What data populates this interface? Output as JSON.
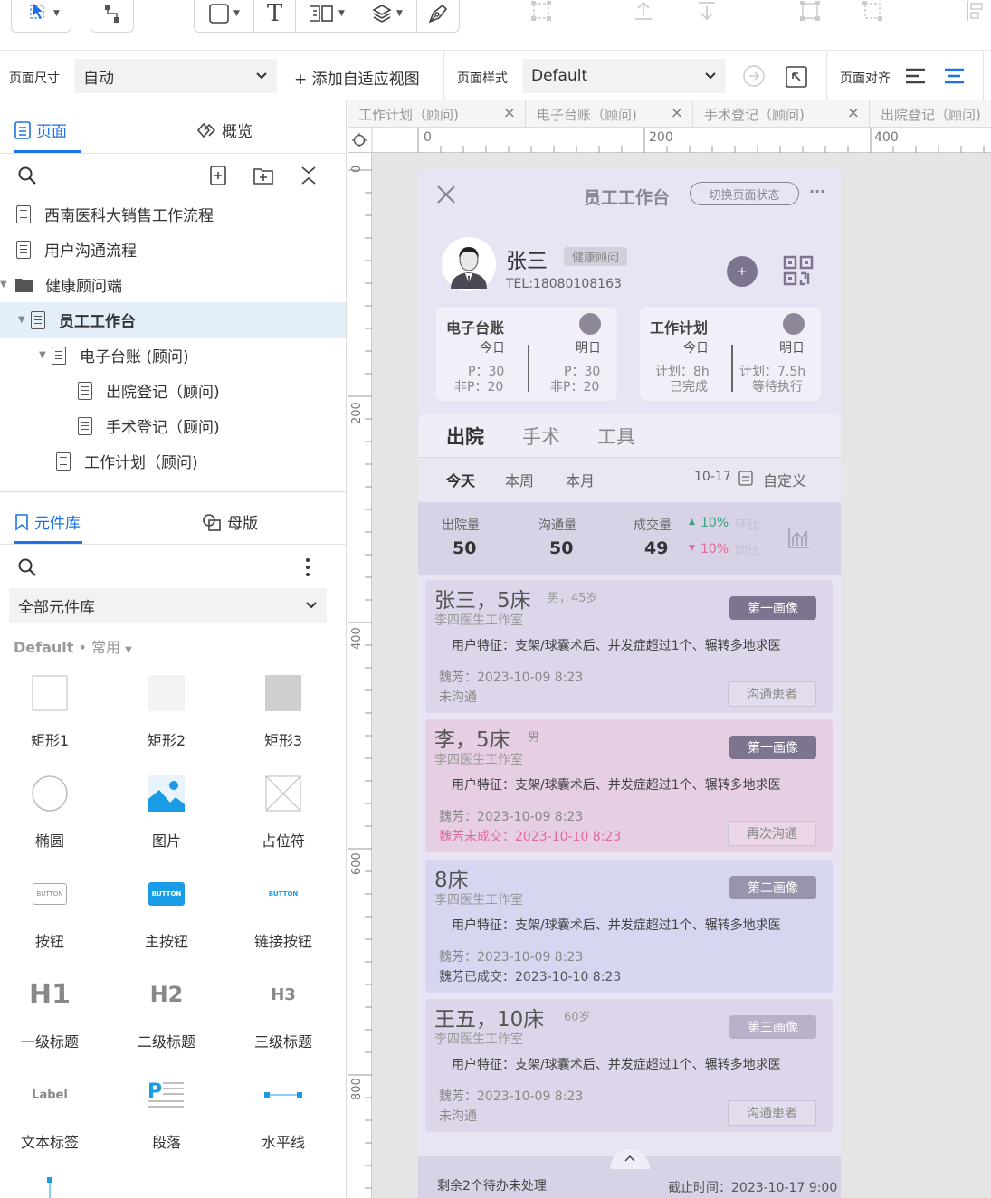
{
  "toolbar": {
    "text_tool": "T",
    "align_icons": [
      "align-top-icon",
      "align-bottom-icon",
      "distribute-h-icon",
      "distribute-v-icon",
      "send-back-icon",
      "bring-front-icon",
      "align-left-icon"
    ]
  },
  "pagebar": {
    "size_label": "页面尺寸",
    "size_value": "自动",
    "add_adaptive": "+ 添加自适应视图",
    "style_label": "页面样式",
    "style_value": "Default",
    "align_label": "页面对齐"
  },
  "left": {
    "tabs": {
      "pages": "页面",
      "overview": "概览"
    },
    "tree": [
      {
        "label": "西南医科大销售工作流程"
      },
      {
        "label": "用户沟通流程"
      },
      {
        "label": "健康顾问端"
      },
      {
        "label": "员工工作台"
      },
      {
        "label": "电子台账 (顾问)"
      },
      {
        "label": "出院登记（顾问)"
      },
      {
        "label": "手术登记（顾问)"
      },
      {
        "label": "工作计划（顾问)"
      }
    ],
    "lib_tabs": {
      "library": "元件库",
      "masters": "母版"
    },
    "lib_select": "全部元件库",
    "lib_default": "Default",
    "lib_dot": "•",
    "lib_common": "常用",
    "components": [
      {
        "label": "矩形1"
      },
      {
        "label": "矩形2"
      },
      {
        "label": "矩形3"
      },
      {
        "label": "椭圆"
      },
      {
        "label": "图片"
      },
      {
        "label": "占位符"
      },
      {
        "label": "按钮",
        "btn": "BUTTON"
      },
      {
        "label": "主按钮",
        "btn": "BUTTON"
      },
      {
        "label": "链接按钮",
        "btn": "BUTTON"
      },
      {
        "label": "一级标题",
        "glyph": "H1"
      },
      {
        "label": "二级标题",
        "glyph": "H2"
      },
      {
        "label": "三级标题",
        "glyph": "H3"
      },
      {
        "label": "文本标签",
        "glyph": "Label"
      },
      {
        "label": "段落"
      },
      {
        "label": "水平线"
      }
    ]
  },
  "editor_tabs": [
    {
      "label": "工作计划（顾问)"
    },
    {
      "label": "电子台账（顾问)"
    },
    {
      "label": "手术登记（顾问)"
    },
    {
      "label": "出院登记（顾问)"
    }
  ],
  "ruler": {
    "h": [
      "0",
      "200",
      "400"
    ],
    "v": [
      "0",
      "200",
      "400",
      "600",
      "800"
    ]
  },
  "phone": {
    "title": "员工工作台",
    "switch_state": "切换页面状态",
    "more": "···",
    "user": {
      "name": "张三",
      "role": "健康顾问",
      "tel": "TEL:18080108163"
    },
    "ledger": {
      "title": "电子台账",
      "today": "今日",
      "tomorrow": "明日",
      "today_p": "P：30",
      "today_np": "非P：20",
      "tomorrow_p": "P：30",
      "tomorrow_np": "非P：20"
    },
    "plan": {
      "title": "工作计划",
      "today": "今日",
      "tomorrow": "明日",
      "today_plan": "计划：8h",
      "today_status": "已完成",
      "tomorrow_plan": "计划：7.5h",
      "tomorrow_status": "等待执行"
    },
    "tabs": [
      "出院",
      "手术",
      "工具"
    ],
    "periods": [
      "今天",
      "本周",
      "本月"
    ],
    "date": "10-17",
    "custom": "自定义",
    "stats": {
      "discharge_label": "出院量",
      "discharge_value": "50",
      "comm_label": "沟通量",
      "comm_value": "50",
      "deal_label": "成交量",
      "deal_value": "49",
      "mom_value": "10%",
      "mom_label": "环比",
      "yoy_value": "10%",
      "yoy_label": "同比"
    },
    "cards": [
      {
        "name": "张三，5床",
        "meta": "男，45岁",
        "clinic": "李四医生工作室",
        "badge": "第一画像",
        "feature": "用户特征：支架/球囊术后、并发症超过1个、辗转多地求医",
        "line1": "魏芳：2023-10-09 8:23",
        "line2": "未沟通",
        "action": "沟通患者",
        "bg": "#ddd6ea",
        "badge_bg": "#7d7590"
      },
      {
        "name": "李，5床",
        "meta": "男",
        "clinic": "李四医生工作室",
        "badge": "第一画像",
        "feature": "用户特征：支架/球囊术后、并发症超过1个、辗转多地求医",
        "line1": "魏芳：2023-10-09 8:23",
        "line2": "魏芳未成交：2023-10-10 8:23",
        "action": "再次沟通",
        "bg": "#e7cfe3",
        "badge_bg": "#7d7590"
      },
      {
        "name": "8床",
        "meta": "",
        "clinic": "李四医生工作室",
        "badge": "第二画像",
        "feature": "用户特征：支架/球囊术后、并发症超过1个、辗转多地求医",
        "line1": "魏芳：2023-10-09 8:23",
        "line2": "魏芳已成交：2023-10-10 8:23",
        "action": "",
        "bg": "#d6d6f0",
        "badge_bg": "#9a93ad"
      },
      {
        "name": "王五，10床",
        "meta": "60岁",
        "clinic": "李四医生工作室",
        "badge": "第三画像",
        "feature": "用户特征：支架/球囊术后、并发症超过1个、辗转多地求医",
        "line1": "魏芳：2023-10-09 8:23",
        "line2": "未沟通",
        "action": "沟通患者",
        "bg": "#ddd6ea",
        "badge_bg": "#b8b1c8"
      }
    ],
    "footer": {
      "pending": "剩余2个待办未处理",
      "deadline": "截止时间：2023-10-17 9:00"
    }
  }
}
